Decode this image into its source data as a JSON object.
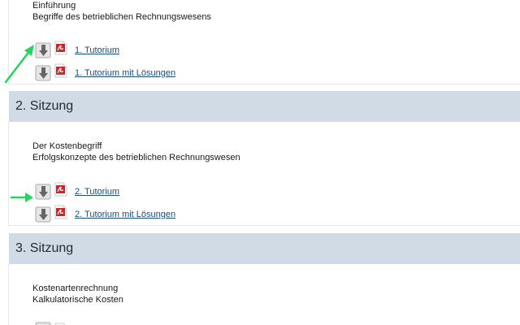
{
  "icons": {
    "download": "download-icon",
    "pdf": "pdf-icon",
    "annotation_arrow": "green-arrow"
  },
  "colors": {
    "section_header_bg": "#d1dbe5",
    "link": "#1a4d7a",
    "annotation_arrow": "#22d65a"
  },
  "sections": [
    {
      "title": "",
      "topics": [
        "Einführung",
        "Begriffe des betrieblichen Rechnungswesens"
      ],
      "files": [
        {
          "label": "1. Tutorium",
          "icon": "pdf-icon"
        },
        {
          "label": "1. Tutorium mit Lösungen",
          "icon": "pdf-icon"
        }
      ]
    },
    {
      "title": "2. Sitzung",
      "topics": [
        "Der Kostenbegriff",
        "Erfolgskonzepte des betrieblichen Rechnungswesen"
      ],
      "files": [
        {
          "label": "2. Tutorium",
          "icon": "pdf-icon"
        },
        {
          "label": "2. Tutorium mit Lösungen",
          "icon": "pdf-icon"
        }
      ]
    },
    {
      "title": "3. Sitzung",
      "topics": [
        "Kostenartenrechnung",
        "Kalkulatorische Kosten"
      ],
      "files": []
    }
  ]
}
